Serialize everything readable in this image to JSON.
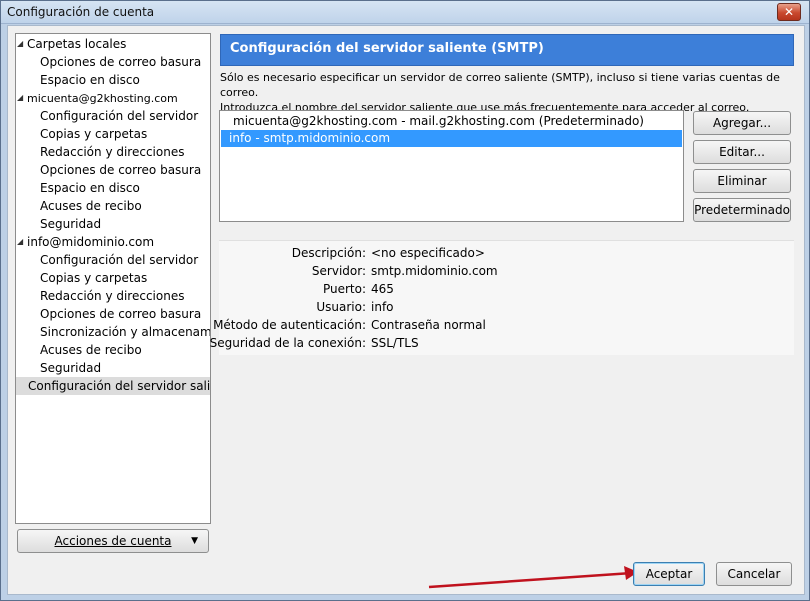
{
  "window": {
    "title": "Configuración de cuenta",
    "close_glyph": "✕"
  },
  "tree": {
    "items": [
      {
        "label": "Carpetas locales",
        "level": "root",
        "expanded": true
      },
      {
        "label": "Opciones de correo basura",
        "level": "child"
      },
      {
        "label": "Espacio en disco",
        "level": "child"
      },
      {
        "label": "micuenta@g2khosting.com",
        "level": "root",
        "expanded": true
      },
      {
        "label": "Configuración del servidor",
        "level": "child"
      },
      {
        "label": "Copias y carpetas",
        "level": "child"
      },
      {
        "label": "Redacción y direcciones",
        "level": "child"
      },
      {
        "label": "Opciones de correo basura",
        "level": "child"
      },
      {
        "label": "Espacio en disco",
        "level": "child"
      },
      {
        "label": "Acuses de recibo",
        "level": "child"
      },
      {
        "label": "Seguridad",
        "level": "child"
      },
      {
        "label": "info@midominio.com",
        "level": "root",
        "expanded": true
      },
      {
        "label": "Configuración del servidor",
        "level": "child"
      },
      {
        "label": "Copias y carpetas",
        "level": "child"
      },
      {
        "label": "Redacción y direcciones",
        "level": "child"
      },
      {
        "label": "Opciones de correo basura",
        "level": "child"
      },
      {
        "label": "Sincronización y almacenami...",
        "level": "child"
      },
      {
        "label": "Acuses de recibo",
        "level": "child"
      },
      {
        "label": "Seguridad",
        "level": "child"
      },
      {
        "label": "Configuración del servidor salie...",
        "level": "selected"
      }
    ]
  },
  "account_actions_button": "Acciones de cuenta",
  "main": {
    "header": "Configuración del servidor saliente (SMTP)",
    "description_line1": "Sólo es necesario especificar un servidor de correo saliente (SMTP), incluso si tiene varias cuentas de correo.",
    "description_line2": "Introduzca el nombre del servidor saliente que use más frecuentemente para acceder al correo.",
    "servers": [
      {
        "label": "micuenta@g2khosting.com - mail.g2khosting.com (Predeterminado)",
        "selected": false
      },
      {
        "label": "info - smtp.midominio.com",
        "selected": true
      }
    ],
    "buttons": {
      "add": "Agregar...",
      "edit": "Editar...",
      "remove": "Eliminar",
      "set_default": "Predeterminado"
    },
    "details": {
      "description_label": "Descripción:",
      "description_value": "<no especificado>",
      "server_label": "Servidor:",
      "server_value": "smtp.midominio.com",
      "port_label": "Puerto:",
      "port_value": "465",
      "user_label": "Usuario:",
      "user_value": "info",
      "auth_label": "Método de autenticación:",
      "auth_value": "Contraseña normal",
      "security_label": "Seguridad de la conexión:",
      "security_value": "SSL/TLS"
    }
  },
  "footer": {
    "accept": "Aceptar",
    "cancel": "Cancelar"
  },
  "colors": {
    "header_bg": "#3d7fd9",
    "selection": "#3399ff",
    "annotation_arrow": "#c0121e"
  }
}
